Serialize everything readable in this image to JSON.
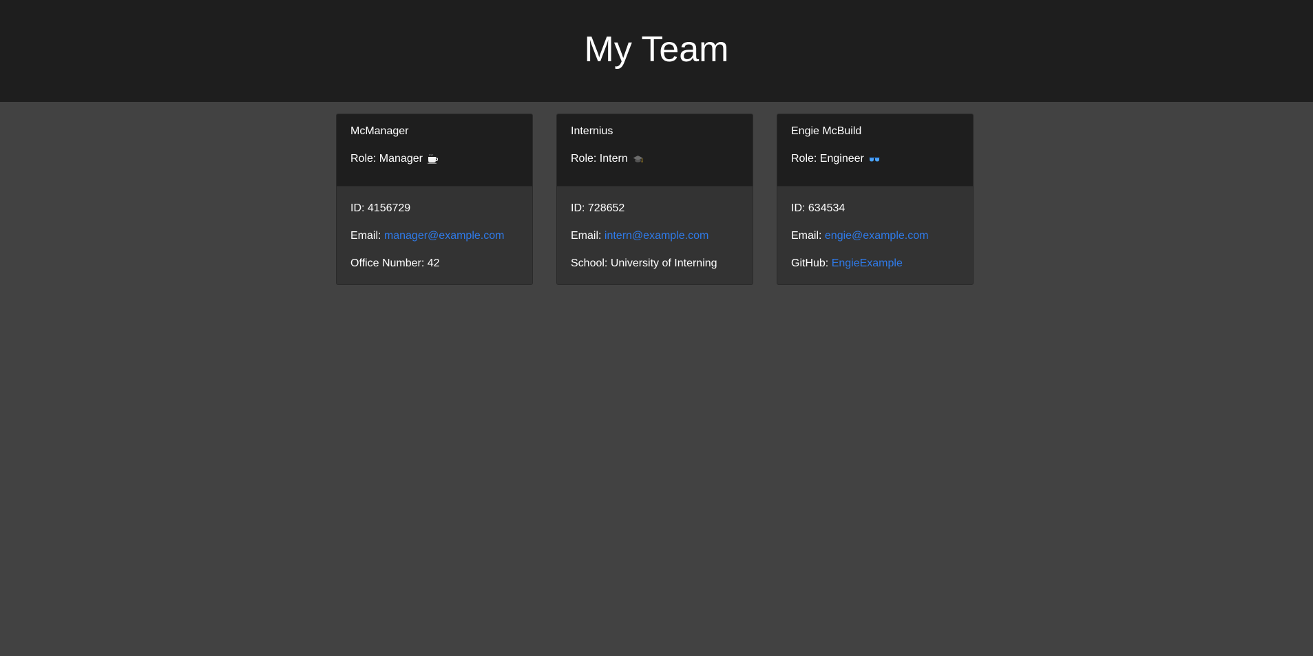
{
  "header": {
    "title": "My Team"
  },
  "cards": [
    {
      "name": "McManager",
      "role_label": "Role: Manager",
      "role_icon": "coffee-icon",
      "id_line": "ID: 4156729",
      "email_prefix": "Email: ",
      "email": "manager@example.com",
      "extra_prefix": "Office Number: 42",
      "extra_link": ""
    },
    {
      "name": "Internius",
      "role_label": "Role: Intern",
      "role_icon": "graduation-cap-icon",
      "id_line": "ID: 728652",
      "email_prefix": "Email: ",
      "email": "intern@example.com",
      "extra_prefix": "School: University of Interning",
      "extra_link": ""
    },
    {
      "name": "Engie McBuild",
      "role_label": "Role: Engineer",
      "role_icon": "glasses-icon",
      "id_line": "ID: 634534",
      "email_prefix": "Email: ",
      "email": "engie@example.com",
      "extra_prefix": "GitHub: ",
      "extra_link": "EngieExample"
    }
  ],
  "colors": {
    "header_bg": "#1e1e1e",
    "page_bg": "#424242",
    "card_body_bg": "#333333",
    "link": "#2f7bea",
    "glasses_accent": "#4aa3ff"
  }
}
